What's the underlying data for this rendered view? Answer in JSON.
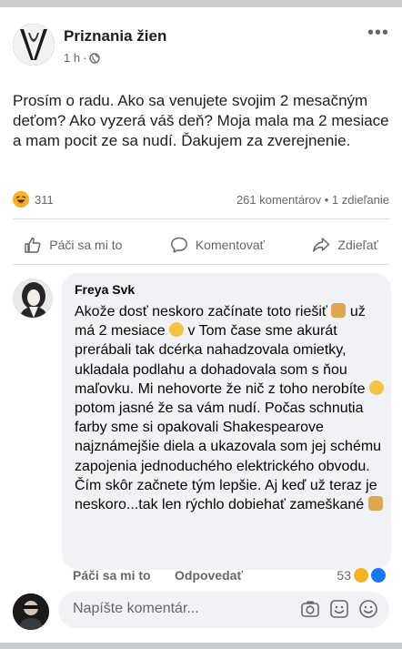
{
  "post": {
    "page_name": "Priznania žien",
    "time": "1 h",
    "separator": "·",
    "more": "•••",
    "text": "Prosím o radu. Ako sa venujete svojim 2 mesačným deťom? Ako vyzerá váš deň? Moja mala ma 2 mesiace a mam pocit ze sa nudí. Ďakujem za zverejnenie.",
    "reaction_count": "311",
    "comments_shares": "261 komentárov • 1 zdieľanie"
  },
  "actions": {
    "like": "Páči sa mi to",
    "comment": "Komentovať",
    "share": "Zdieľať"
  },
  "comment": {
    "author": "Freya Svk",
    "text_parts": [
      "Akože dosť neskoro začínate toto riešiť ",
      " už má 2 mesiace ",
      " v Tom čase sme akurát prerábali tak dcérka nahadzovala omietky, ukladala podlahu a dohadovala som s ňou maľovku. Mi nehovorte že nič z toho nerobíte ",
      " potom jasné že sa vám nudí. Počas schnutia farby sme si opakovali Shakespearove najznámejšie diela a ukazovala som jej schému zapojenia jednoduchého elektrického obvodu. Čím skôr začnete tým lepšie. Aj keď už teraz je neskoro...tak len rýchlo dobiehať zameškané "
    ],
    "like_label": "Páči sa mi to",
    "reply_label": "Odpovedať",
    "reaction_count": "53"
  },
  "composer": {
    "placeholder": "Napíšte komentár..."
  },
  "colors": {
    "haha": "#f7b125",
    "like_blue": "#1877f2",
    "muted": "#65676b"
  }
}
